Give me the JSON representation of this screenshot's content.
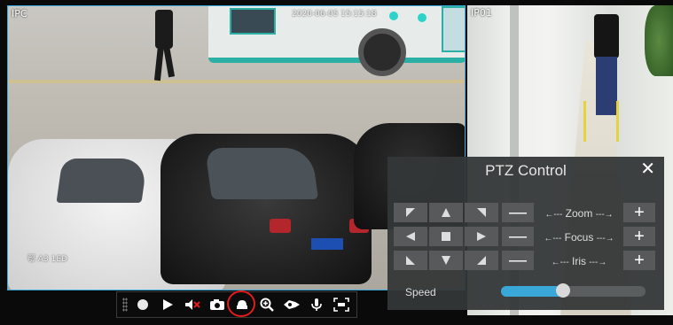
{
  "cameras": {
    "left": {
      "label": "IPC",
      "timestamp_overlay": "2020-06-05 15:15:18",
      "plate_overlay": "鄂 A3 1ED"
    },
    "right": {
      "label": "IP01"
    }
  },
  "toolbar": {
    "items": [
      {
        "icon": "record-icon"
      },
      {
        "icon": "play-icon"
      },
      {
        "icon": "mute-icon"
      },
      {
        "icon": "snapshot-icon"
      },
      {
        "icon": "ptz-icon",
        "highlighted": true
      },
      {
        "icon": "zoom-in-icon"
      },
      {
        "icon": "fisheye-icon"
      },
      {
        "icon": "microphone-icon"
      },
      {
        "icon": "fullscreen-icon"
      }
    ],
    "highlight_color": "#e21b1b"
  },
  "ptz": {
    "title": "PTZ Control",
    "close_label": "✕",
    "rows": [
      {
        "label": "Zoom",
        "minus": "—",
        "plus": "+"
      },
      {
        "label": "Focus",
        "minus": "—",
        "plus": "+"
      },
      {
        "label": "Iris",
        "minus": "—",
        "plus": "+"
      }
    ],
    "arrow_left": "←---",
    "arrow_right": "---→",
    "speed_label": "Speed",
    "speed_fraction": 0.43,
    "accent_color": "#3aa7d9"
  }
}
